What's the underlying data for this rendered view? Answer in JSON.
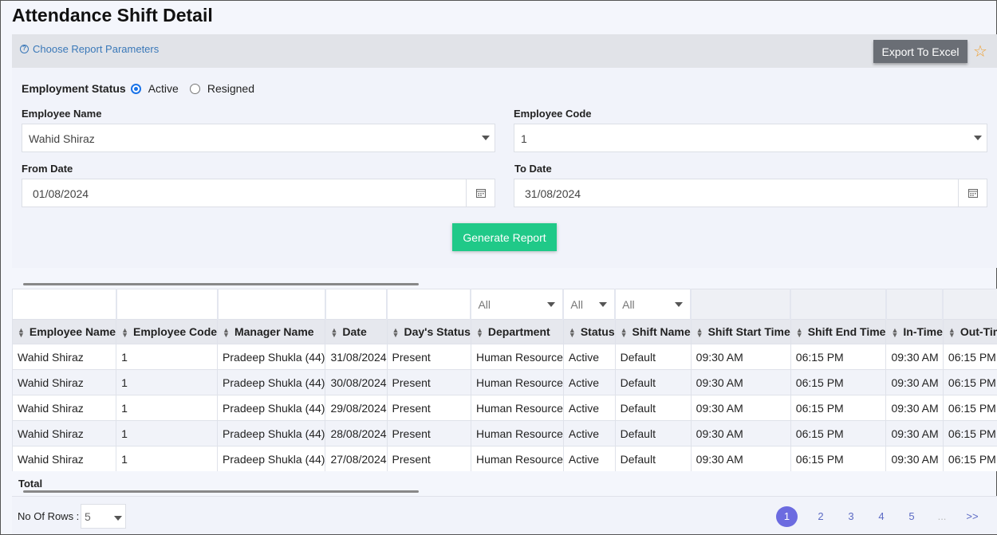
{
  "title": "Attendance Shift Detail",
  "params": {
    "toggle_label": "Choose Report Parameters",
    "export_label": "Export To Excel"
  },
  "form": {
    "employment_status_label": "Employment Status",
    "status_options": [
      "Active",
      "Resigned"
    ],
    "status_selected": "Active",
    "employee_name_label": "Employee Name",
    "employee_name_value": "Wahid Shiraz",
    "employee_code_label": "Employee Code",
    "employee_code_value": "1",
    "from_date_label": "From Date",
    "from_date_value": "01/08/2024",
    "to_date_label": "To Date",
    "to_date_value": "31/08/2024",
    "generate_label": "Generate Report"
  },
  "table": {
    "filters": {
      "department": "All",
      "status": "All",
      "shift_name": "All"
    },
    "columns": [
      "Employee Name",
      "Employee Code",
      "Manager Name",
      "Date",
      "Day's Status",
      "Department",
      "Status",
      "Shift Name",
      "Shift Start Time",
      "Shift End Time",
      "In-Time",
      "Out-Time"
    ],
    "rows": [
      [
        "Wahid Shiraz",
        "1",
        "Pradeep Shukla (44)",
        "31/08/2024",
        "Present",
        "Human Resource",
        "Active",
        "Default",
        "09:30 AM",
        "06:15 PM",
        "09:30 AM",
        "06:15 PM"
      ],
      [
        "Wahid Shiraz",
        "1",
        "Pradeep Shukla (44)",
        "30/08/2024",
        "Present",
        "Human Resource",
        "Active",
        "Default",
        "09:30 AM",
        "06:15 PM",
        "09:30 AM",
        "06:15 PM"
      ],
      [
        "Wahid Shiraz",
        "1",
        "Pradeep Shukla (44)",
        "29/08/2024",
        "Present",
        "Human Resource",
        "Active",
        "Default",
        "09:30 AM",
        "06:15 PM",
        "09:30 AM",
        "06:15 PM"
      ],
      [
        "Wahid Shiraz",
        "1",
        "Pradeep Shukla (44)",
        "28/08/2024",
        "Present",
        "Human Resource",
        "Active",
        "Default",
        "09:30 AM",
        "06:15 PM",
        "09:30 AM",
        "06:15 PM"
      ],
      [
        "Wahid Shiraz",
        "1",
        "Pradeep Shukla (44)",
        "27/08/2024",
        "Present",
        "Human Resource",
        "Active",
        "Default",
        "09:30 AM",
        "06:15 PM",
        "09:30 AM",
        "06:15 PM"
      ]
    ],
    "total_label": "Total"
  },
  "footer": {
    "rows_label": "No Of Rows :",
    "rows_value": "5",
    "pages": [
      "1",
      "2",
      "3",
      "4",
      "5",
      "...",
      ">>"
    ],
    "active_page": "1"
  },
  "colors": {
    "export_button": "#6a6e75",
    "generate_button": "#20c988",
    "active_page": "#6c6be0",
    "link": "#3a78b8"
  }
}
